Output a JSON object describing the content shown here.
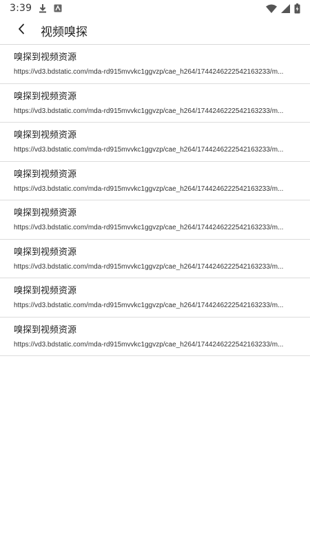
{
  "status_bar": {
    "time": "3:39",
    "icons": [
      "download-icon",
      "app-notification-icon",
      "wifi-icon",
      "signal-icon",
      "battery-charging-icon"
    ]
  },
  "app_bar": {
    "back_icon": "chevron-left-icon",
    "title": "视频嗅探"
  },
  "list": {
    "items": [
      {
        "title": "嗅探到视频资源",
        "url": "https://vd3.bdstatic.com/mda-rd915mvvkc1ggvzp/cae_h264/1744246222542163233/m..."
      },
      {
        "title": "嗅探到视频资源",
        "url": "https://vd3.bdstatic.com/mda-rd915mvvkc1ggvzp/cae_h264/1744246222542163233/m..."
      },
      {
        "title": "嗅探到视频资源",
        "url": "https://vd3.bdstatic.com/mda-rd915mvvkc1ggvzp/cae_h264/1744246222542163233/m..."
      },
      {
        "title": "嗅探到视频资源",
        "url": "https://vd3.bdstatic.com/mda-rd915mvvkc1ggvzp/cae_h264/1744246222542163233/m..."
      },
      {
        "title": "嗅探到视频资源",
        "url": "https://vd3.bdstatic.com/mda-rd915mvvkc1ggvzp/cae_h264/1744246222542163233/m..."
      },
      {
        "title": "嗅探到视频资源",
        "url": "https://vd3.bdstatic.com/mda-rd915mvvkc1ggvzp/cae_h264/1744246222542163233/m..."
      },
      {
        "title": "嗅探到视频资源",
        "url": "https://vd3.bdstatic.com/mda-rd915mvvkc1ggvzp/cae_h264/1744246222542163233/m..."
      },
      {
        "title": "嗅探到视频资源",
        "url": "https://vd3.bdstatic.com/mda-rd915mvvkc1ggvzp/cae_h264/1744246222542163233/m..."
      }
    ]
  }
}
